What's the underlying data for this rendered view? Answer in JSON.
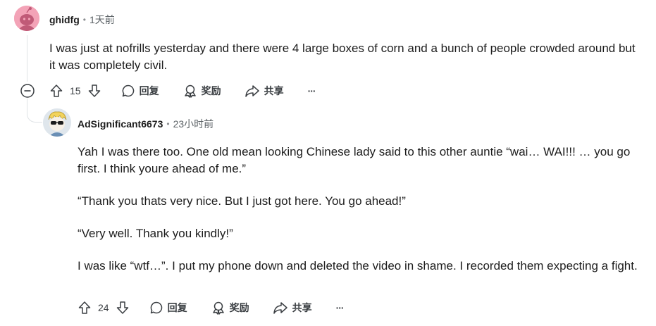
{
  "comment1": {
    "username": "ghidfg",
    "time": "1天前",
    "body": "I was just at nofrills yesterday and there were 4 large boxes of corn and a bunch of people crowded around but it was completely civil.",
    "votes": "15",
    "reply_label": "回复",
    "award_label": "奖励",
    "share_label": "共享",
    "more_label": "···"
  },
  "comment2": {
    "username": "AdSignificant6673",
    "time": "23小时前",
    "paragraphs": [
      "Yah I was there too. One old mean looking Chinese lady said to this other auntie “wai… WAI!!! … you go first. I think youre ahead of me.”",
      "“Thank you thats very nice. But I just got here. You go ahead!”",
      "“Very well. Thank you kindly!”",
      "I was like “wtf…”. I put my phone down and deleted the video in shame. I recorded them expecting a fight."
    ],
    "votes": "24",
    "reply_label": "回复",
    "award_label": "奖励",
    "share_label": "共享",
    "more_label": "···"
  },
  "separator_dot": "•",
  "colors": {
    "avatar1_bg": "#f3a3b7",
    "avatar2_bg": "#dfe6ec",
    "thread_line": "#dfe3e6"
  }
}
